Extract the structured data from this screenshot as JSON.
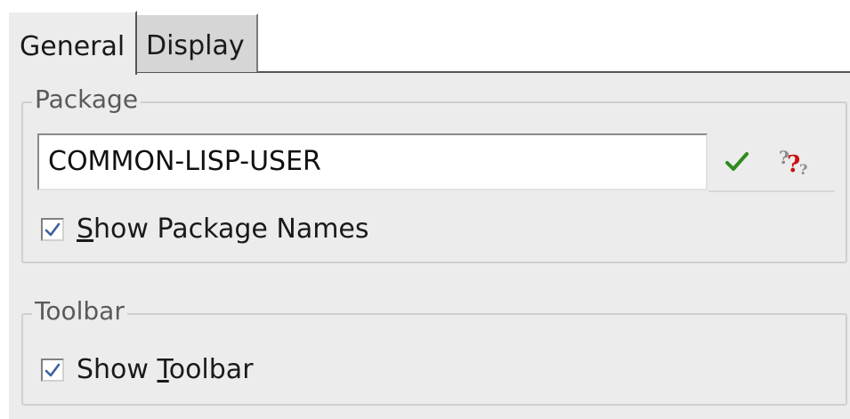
{
  "tabs": {
    "general": "General",
    "display": "Display"
  },
  "package_group": {
    "title": "Package",
    "package_field_value": "COMMON-LISP-USER",
    "ok_icon": "green-checkmark-icon",
    "help_icon": "question-mark-help-icon",
    "show_package_names": {
      "label_mnemonic": "S",
      "label_rest": "how Package Names",
      "checked": true
    }
  },
  "toolbar_group": {
    "title": "Toolbar",
    "show_toolbar": {
      "label_before": "Show ",
      "label_mnemonic": "T",
      "label_rest": "oolbar",
      "checked": true
    }
  },
  "colors": {
    "panel": "#ececec",
    "check_accent": "#3c5fa0",
    "ok_green": "#2e8b1e",
    "help_red": "#cc1010"
  }
}
